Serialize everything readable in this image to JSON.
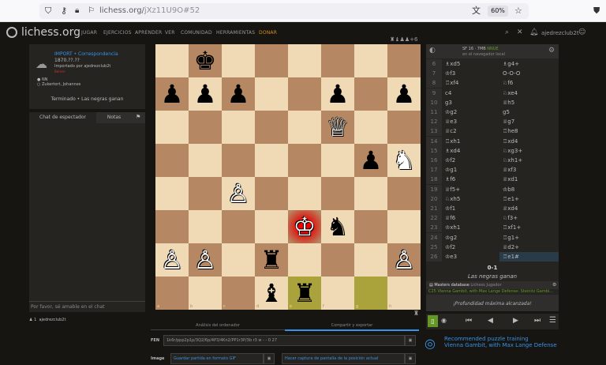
{
  "browser": {
    "url_host": "lichess.org/",
    "url_path": "jXz11U9O#52",
    "zoom": "60%"
  },
  "site": {
    "name": "lichess.org"
  },
  "nav": [
    "JUGAR",
    "EJERCICIOS",
    "APRENDER",
    "VER",
    "COMUNIDAD",
    "HERRAMIENTAS",
    "DONAR"
  ],
  "game": {
    "import_label": "IMPORT",
    "type": "Correspondencia",
    "date": "1870.??.??",
    "imported_by": "Importado por ajedrezclub2t",
    "variant": "Berner",
    "white": "NN",
    "black": "Zukertort, Johannes",
    "result_text": "Terminado • Las negras ganan"
  },
  "chat": {
    "tab1": "Chat de espectador",
    "tab2": "Notas",
    "placeholder": "Por favor, sé amable en el chat",
    "viewer": "ajedrezclub2t",
    "viewer_count": "1"
  },
  "engine": {
    "name": "SF 16 · 7MB",
    "tag": "NNUE",
    "sub": "en el navegador local"
  },
  "moves": [
    {
      "n": "6",
      "w": "♗xd5",
      "b": "♗g4+"
    },
    {
      "n": "7",
      "w": "♔f3",
      "b": "O-O-O"
    },
    {
      "n": "8",
      "w": "♖xf4",
      "b": "♘f6"
    },
    {
      "n": "9",
      "w": "c4",
      "b": "♘xe4"
    },
    {
      "n": "10",
      "w": "g3",
      "b": "♕h5"
    },
    {
      "n": "11",
      "w": "♔g2",
      "b": "g5"
    },
    {
      "n": "12",
      "w": "♕e3",
      "b": "♕g7"
    },
    {
      "n": "13",
      "w": "♕c2",
      "b": "♖he8"
    },
    {
      "n": "14",
      "w": "♖xh1",
      "b": "♖xd4"
    },
    {
      "n": "15",
      "w": "♗xd4",
      "b": "♘xg3+"
    },
    {
      "n": "16",
      "w": "♔f2",
      "b": "♘xh1+"
    },
    {
      "n": "17",
      "w": "♔g1",
      "b": "♕xf3"
    },
    {
      "n": "18",
      "w": "♗f6",
      "b": "♕xd1"
    },
    {
      "n": "19",
      "w": "♕f5+",
      "b": "♔b8"
    },
    {
      "n": "20",
      "w": "♘xh5",
      "b": "♖e1+"
    },
    {
      "n": "21",
      "w": "♔f1",
      "b": "♕xd4"
    },
    {
      "n": "22",
      "w": "♕f6",
      "b": "♘f3+"
    },
    {
      "n": "23",
      "w": "♔xh1",
      "b": "♖xf1+"
    },
    {
      "n": "24",
      "w": "♔g2",
      "b": "♖g1+"
    },
    {
      "n": "25",
      "w": "♔f2",
      "b": "♕d2+"
    },
    {
      "n": "26",
      "w": "♔e3",
      "b": "♖e1#"
    }
  ],
  "result": {
    "score": "0-1",
    "text": "Las negras ganan"
  },
  "explorer": {
    "title": "Masters database",
    "tab2": "Lichess",
    "tab3": "Jugador",
    "opening": "C25 Vienna Gambit, with Max Lange Defense: Steinitz Gambi...",
    "max_depth": "¡Profundidad máxima alcanzada!"
  },
  "bottom": {
    "tab1": "Análisis del ordenador",
    "tab2": "Compartir y exportar",
    "fen_label": "FEN",
    "fen": "1k6r/ppp2p1p/3Q2/6p/4P3/4Kn2/PP1r3P/3b r3 w - - 0 27",
    "image_label": "Image",
    "gif_btn": "Guardar partida en formato GIF",
    "screenshot_btn": "Hacer captura de pantalla de la posición actual"
  },
  "puzzle": {
    "title": "Recommended puzzle training",
    "subtitle": "Vienna Gambit, with Max Lange Defense"
  },
  "board": {
    "files": [
      "a",
      "b",
      "c",
      "d",
      "e",
      "f",
      "g",
      "h"
    ],
    "ranks": [
      "8",
      "7",
      "6",
      "5",
      "4",
      "3",
      "2",
      "1"
    ],
    "pieces": [
      {
        "sq": "b8",
        "p": "♚",
        "c": "b"
      },
      {
        "sq": "a7",
        "p": "♟",
        "c": "b"
      },
      {
        "sq": "b7",
        "p": "♟",
        "c": "b"
      },
      {
        "sq": "c7",
        "p": "♟",
        "c": "b"
      },
      {
        "sq": "f7",
        "p": "♟",
        "c": "b"
      },
      {
        "sq": "h7",
        "p": "♟",
        "c": "b"
      },
      {
        "sq": "f6",
        "p": "♕",
        "c": "w"
      },
      {
        "sq": "g5",
        "p": "♟",
        "c": "b"
      },
      {
        "sq": "h5",
        "p": "♞",
        "c": "w"
      },
      {
        "sq": "c4",
        "p": "♙",
        "c": "w"
      },
      {
        "sq": "e3",
        "p": "♔",
        "c": "w"
      },
      {
        "sq": "f3",
        "p": "♞",
        "c": "b"
      },
      {
        "sq": "a2",
        "p": "♙",
        "c": "w"
      },
      {
        "sq": "b2",
        "p": "♙",
        "c": "w"
      },
      {
        "sq": "d2",
        "p": "♜",
        "c": "b"
      },
      {
        "sq": "h2",
        "p": "♙",
        "c": "w"
      },
      {
        "sq": "d1",
        "p": "♝",
        "c": "b"
      },
      {
        "sq": "e1",
        "p": "♜",
        "c": "b"
      }
    ],
    "check": "e3",
    "last_from": "g1",
    "last_to": "e1"
  },
  "colors": {
    "accent": "#3692e7",
    "win": "#629924",
    "bg": "#161512"
  }
}
